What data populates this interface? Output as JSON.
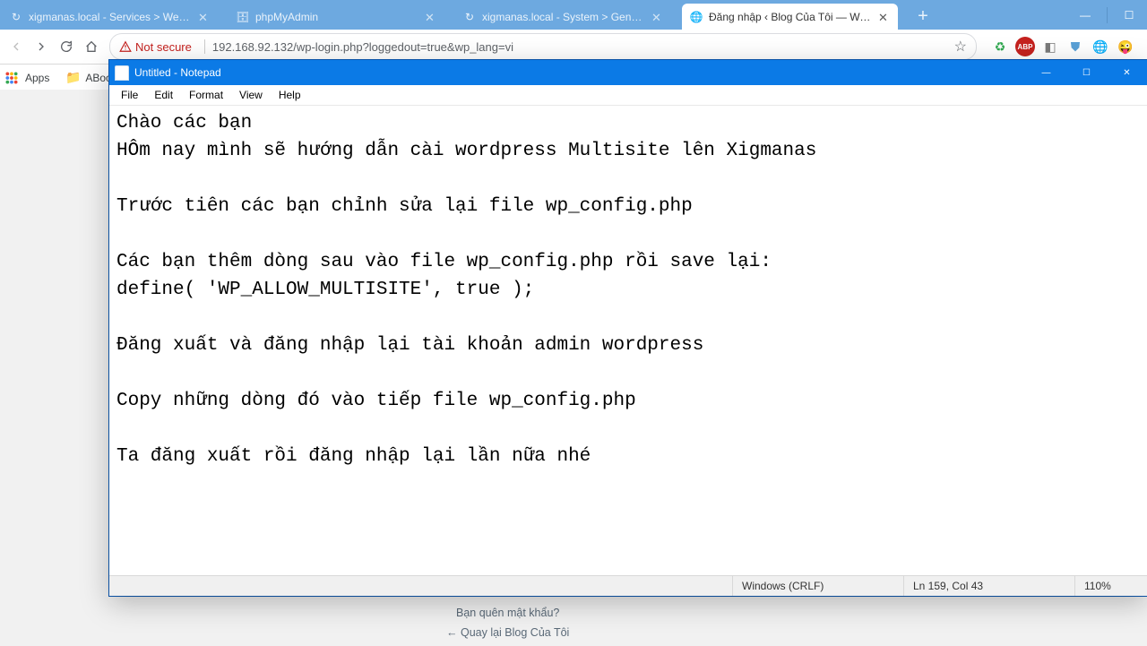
{
  "browser": {
    "tabs": [
      {
        "title": "xigmanas.local - Services > Web…",
        "favicon": "↻"
      },
      {
        "title": "phpMyAdmin",
        "favicon": "🗄"
      },
      {
        "title": "xigmanas.local - System > Gene…",
        "favicon": "↻"
      },
      {
        "title": "Đăng nhập ‹ Blog Của Tôi — Wo…",
        "favicon": "🌐"
      }
    ],
    "active_tab": 3,
    "address": {
      "warning_label": "Not secure",
      "url": "192.168.92.132/wp-login.php?loggedout=true&wp_lang=vi"
    },
    "bookmarks": {
      "apps": "Apps",
      "folder": "ABookmar"
    }
  },
  "page": {
    "forgot_pw": "Bạn quên mật khẩu?",
    "back_link": "← Quay lại Blog Của Tôi"
  },
  "notepad": {
    "title": "Untitled - Notepad",
    "menu": [
      "File",
      "Edit",
      "Format",
      "View",
      "Help"
    ],
    "lines": [
      "Chào các bạn",
      "HÔm nay mình sẽ hướng dẫn cài wordpress Multisite lên Xigmanas",
      "",
      "Trước tiên các bạn chỉnh sửa lại file wp_config.php",
      "",
      "Các bạn thêm dòng sau vào file wp_config.php rồi save lại:",
      "define( 'WP_ALLOW_MULTISITE', true );",
      "",
      "Đăng xuất và đăng nhập lại tài khoản admin wordpress",
      "",
      "Copy những dòng đó vào tiếp file wp_config.php",
      "",
      "Ta đăng xuất rồi đăng nhập lại lần nữa nhé"
    ],
    "status": {
      "encoding": "Windows (CRLF)",
      "pos": "Ln 159, Col 43",
      "zoom": "110%"
    }
  }
}
